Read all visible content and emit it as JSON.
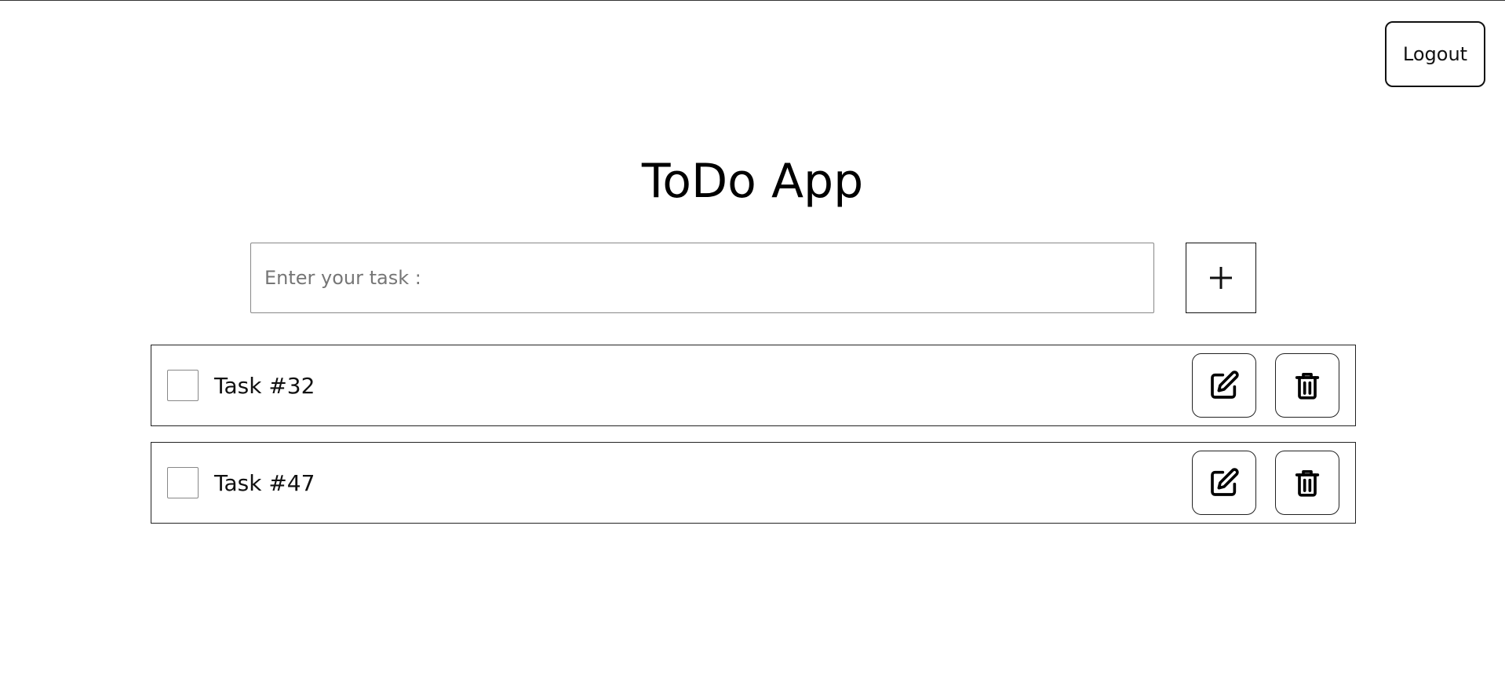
{
  "header": {
    "logout_label": "Logout"
  },
  "title": "ToDo App",
  "input": {
    "placeholder": "Enter your task :",
    "value": ""
  },
  "add_button": {
    "icon": "plus-icon"
  },
  "tasks": [
    {
      "label": "Task #32",
      "checked": false,
      "edit_icon": "edit-icon",
      "delete_icon": "trash-icon"
    },
    {
      "label": "Task #47",
      "checked": false,
      "edit_icon": "edit-icon",
      "delete_icon": "trash-icon"
    }
  ],
  "colors": {
    "background": "#ffffff",
    "text": "#000000",
    "border": "#222222",
    "placeholder": "#767676"
  }
}
